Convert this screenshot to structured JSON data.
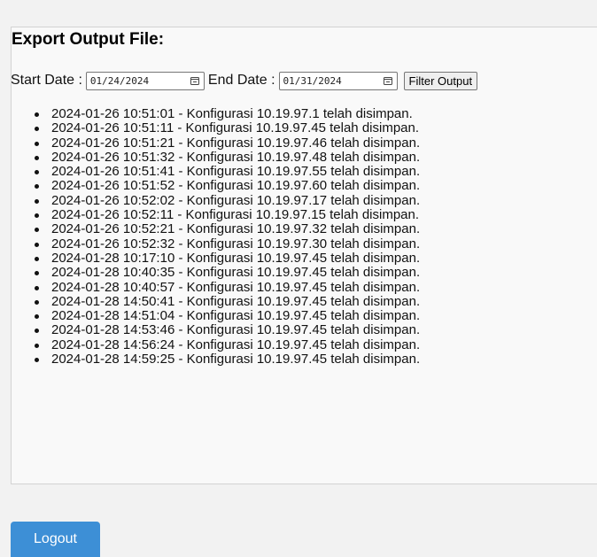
{
  "export": {
    "title": "Export Output File:",
    "start_label": "Start Date :",
    "start_value": "01/24/2024",
    "end_label": "End Date :",
    "end_value": "01/31/2024",
    "filter_label": "Filter Output"
  },
  "logs": [
    "2024-01-26 10:51:01 - Konfigurasi 10.19.97.1 telah disimpan.",
    "2024-01-26 10:51:11 - Konfigurasi 10.19.97.45 telah disimpan.",
    "2024-01-26 10:51:21 - Konfigurasi 10.19.97.46 telah disimpan.",
    "2024-01-26 10:51:32 - Konfigurasi 10.19.97.48 telah disimpan.",
    "2024-01-26 10:51:41 - Konfigurasi 10.19.97.55 telah disimpan.",
    "2024-01-26 10:51:52 - Konfigurasi 10.19.97.60 telah disimpan.",
    "2024-01-26 10:52:02 - Konfigurasi 10.19.97.17 telah disimpan.",
    "2024-01-26 10:52:11 - Konfigurasi 10.19.97.15 telah disimpan.",
    "2024-01-26 10:52:21 - Konfigurasi 10.19.97.32 telah disimpan.",
    "2024-01-26 10:52:32 - Konfigurasi 10.19.97.30 telah disimpan.",
    "2024-01-28 10:17:10 - Konfigurasi 10.19.97.45 telah disimpan.",
    "2024-01-28 10:40:35 - Konfigurasi 10.19.97.45 telah disimpan.",
    "2024-01-28 10:40:57 - Konfigurasi 10.19.97.45 telah disimpan.",
    "2024-01-28 14:50:41 - Konfigurasi 10.19.97.45 telah disimpan.",
    "2024-01-28 14:51:04 - Konfigurasi 10.19.97.45 telah disimpan.",
    "2024-01-28 14:53:46 - Konfigurasi 10.19.97.45 telah disimpan.",
    "2024-01-28 14:56:24 - Konfigurasi 10.19.97.45 telah disimpan.",
    "2024-01-28 14:59:25 - Konfigurasi 10.19.97.45 telah disimpan."
  ],
  "logout_label": "Logout",
  "colors": {
    "logout_bg": "#3d8fd6",
    "panel_bg": "#f9f9f9",
    "page_bg": "#f2f2f2"
  },
  "icons": {
    "date_picker": "calendar-icon"
  }
}
